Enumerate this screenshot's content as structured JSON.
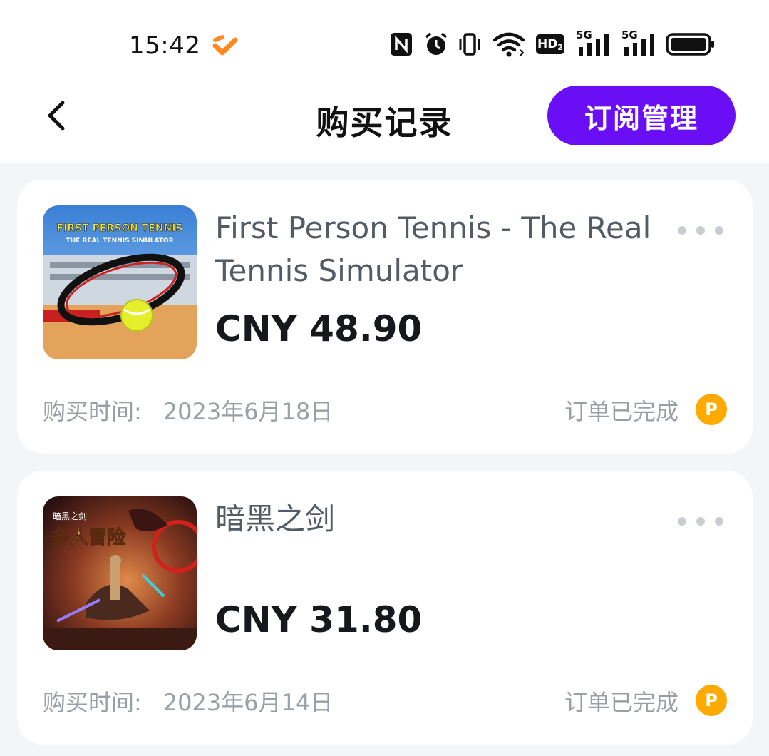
{
  "status_bar": {
    "time": "15:42",
    "icons": [
      "app-logo-icon",
      "nfc-icon",
      "alarm-icon",
      "vibrate-icon",
      "wifi-icon",
      "hd-icon",
      "signal-5g-icon",
      "signal-5g-icon",
      "battery-icon"
    ],
    "hd_label": "HD",
    "hd_sub": "2",
    "net1_label": "5G",
    "net2_label": "5G"
  },
  "header": {
    "title": "购买记录",
    "back_icon": "chevron-left-icon",
    "subscription_button": "订阅管理"
  },
  "colors": {
    "accent": "#6a0ef5",
    "badge": "#ffaa00",
    "background": "#f4f5f7"
  },
  "purchases": [
    {
      "title": "First Person Tennis - The Real Tennis Simulator",
      "price": "CNY 48.90",
      "date_label": "购买时间:",
      "date": "2023年6月18日",
      "status": "订单已完成",
      "badge": "P",
      "thumb_line1": "FIRST PERSON TENNIS",
      "thumb_line2": "THE REAL TENNIS SIMULATOR"
    },
    {
      "title": "暗黑之剑",
      "price": "CNY 31.80",
      "date_label": "购买时间:",
      "date": "2023年6月14日",
      "status": "订单已完成",
      "badge": "P",
      "thumb_line1": "暗黑之剑",
      "thumb_line2": "多人冒险"
    }
  ]
}
